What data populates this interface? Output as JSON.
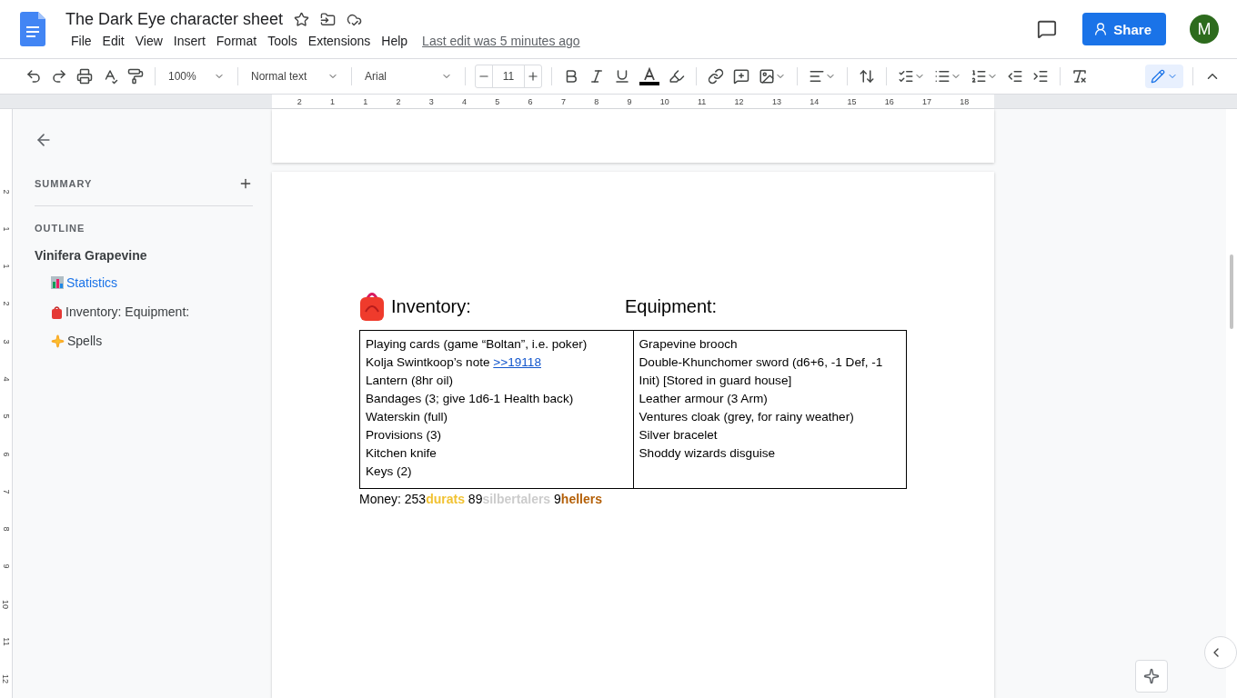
{
  "document": {
    "title": "The Dark Eye character sheet",
    "last_edit": "Last edit was 5 minutes ago"
  },
  "menu": [
    "File",
    "Edit",
    "View",
    "Insert",
    "Format",
    "Tools",
    "Extensions",
    "Help"
  ],
  "header": {
    "share": "Share",
    "avatar": "M"
  },
  "toolbar": {
    "zoom": "100%",
    "style": "Normal text",
    "font": "Arial",
    "font_size": "11"
  },
  "ruler": {
    "horizontal": [
      "2",
      "1",
      "1",
      "2",
      "3",
      "4",
      "5",
      "6",
      "7",
      "8",
      "9",
      "10",
      "11",
      "12",
      "13",
      "14",
      "15",
      "16",
      "17",
      "18"
    ],
    "vertical": [
      "2",
      "1",
      "1",
      "2",
      "3",
      "4",
      "5",
      "6",
      "7",
      "8",
      "9",
      "10",
      "11",
      "12"
    ]
  },
  "sidebar": {
    "summary": "SUMMARY",
    "outline_label": "OUTLINE",
    "outline": [
      {
        "label": "Vinifera Grapevine",
        "selected": false,
        "children": [
          {
            "kind": "chart",
            "label": "Statistics",
            "selected": true
          },
          {
            "kind": "bag",
            "label": "Inventory: Equipment:",
            "selected": false
          },
          {
            "kind": "sparkles",
            "label": "Spells",
            "selected": false
          }
        ]
      }
    ]
  },
  "page": {
    "headings": [
      "Inventory:",
      "Equipment:"
    ],
    "table": {
      "columns": [
        [
          {
            "text": "Playing cards (game “Boltan”, i.e. poker)"
          },
          {
            "text": "Kolja Swintkoop’s note",
            "link": ">>19118"
          },
          {
            "text": "Lantern (8hr oil)"
          },
          {
            "text": "Bandages (3; give 1d6-1 Health back)"
          },
          {
            "text": "Waterskin (full)"
          },
          {
            "text": "Provisions (3)"
          },
          {
            "text": "Kitchen knife"
          },
          {
            "text": "Keys (2)"
          }
        ],
        [
          {
            "text": "Grapevine brooch"
          },
          {
            "text": "Double-Khunchomer sword (d6+6, -1 Def, -1 Init) [Stored in guard house]"
          },
          {
            "text": "Leather armour (3 Arm)"
          },
          {
            "text": "Ventures cloak (grey, for rainy weather)"
          },
          {
            "text": "Silver bracelet"
          },
          {
            "text": "Shoddy wizards disguise"
          }
        ]
      ]
    },
    "money": [
      {
        "text": "Money: 253"
      },
      {
        "text": "durats",
        "color": "#f1c232"
      },
      {
        "text": " 89"
      },
      {
        "text": "silbertalers",
        "color": "#cccccc"
      },
      {
        "text": " 9"
      },
      {
        "text": "hellers",
        "color": "#b45f06"
      }
    ]
  }
}
